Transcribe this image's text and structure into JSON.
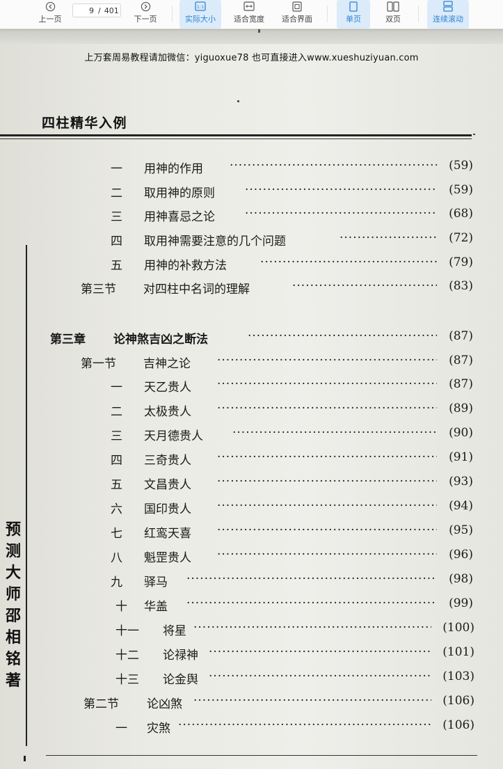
{
  "toolbar": {
    "prev_label": "上一页",
    "next_label": "下一页",
    "page_current": "9",
    "page_sep": "/",
    "page_total": "401",
    "actual_size_label": "实际大小",
    "fit_width_label": "适合宽度",
    "fit_page_label": "适合界面",
    "single_label": "单页",
    "double_label": "双页",
    "continuous_label": "连续滚动",
    "active_color": "#2c82d6",
    "icons": [
      "chevron-left-icon",
      "chevron-right-icon",
      "actual-size-icon",
      "fit-width-icon",
      "fit-page-icon",
      "single-page-icon",
      "double-page-icon",
      "continuous-scroll-icon"
    ]
  },
  "page": {
    "watermark": "上万套周易教程请加微信：yiguoxue78  也可直接进入www.xueshuziyuan.com",
    "running_head": "四柱精华入例",
    "side_author": "预测大师邵相铭著",
    "toc": [
      {
        "num": "一",
        "title": "用神的作用",
        "page": "(59)"
      },
      {
        "num": "二",
        "title": "取用神的原则",
        "page": "(59)"
      },
      {
        "num": "三",
        "title": "用神喜忌之论",
        "page": "(68)"
      },
      {
        "num": "四",
        "title": "取用神需要注意的几个问题",
        "page": "(72)"
      },
      {
        "num": "五",
        "title": "用神的补救方法",
        "page": "(79)"
      },
      {
        "num": "第三节",
        "title": "对四柱中名词的理解",
        "page": "(83)"
      },
      {
        "num": "第三章",
        "title": "论神煞吉凶之断法",
        "page": "(87)"
      },
      {
        "num": "第一节",
        "title": "吉神之论",
        "page": "(87)"
      },
      {
        "num": "一",
        "title": "天乙贵人",
        "page": "(87)"
      },
      {
        "num": "二",
        "title": "太极贵人",
        "page": "(89)"
      },
      {
        "num": "三",
        "title": "天月德贵人",
        "page": "(90)"
      },
      {
        "num": "四",
        "title": "三奇贵人",
        "page": "(91)"
      },
      {
        "num": "五",
        "title": "文昌贵人",
        "page": "(93)"
      },
      {
        "num": "六",
        "title": "国印贵人",
        "page": "(94)"
      },
      {
        "num": "七",
        "title": "红鸾天喜",
        "page": "(95)"
      },
      {
        "num": "八",
        "title": "魁罡贵人",
        "page": "(96)"
      },
      {
        "num": "九",
        "title": "驿马",
        "page": "(98)"
      },
      {
        "num": "十",
        "title": "华盖",
        "page": "(99)"
      },
      {
        "num": "十一",
        "title": "将星",
        "page": "(100)"
      },
      {
        "num": "十二",
        "title": "论禄神",
        "page": "(101)"
      },
      {
        "num": "十三",
        "title": "论金舆",
        "page": "(103)"
      },
      {
        "num": "第二节",
        "title": "论凶煞",
        "page": "(106)"
      },
      {
        "num": "一",
        "title": "灾煞",
        "page": "(106)"
      }
    ]
  }
}
